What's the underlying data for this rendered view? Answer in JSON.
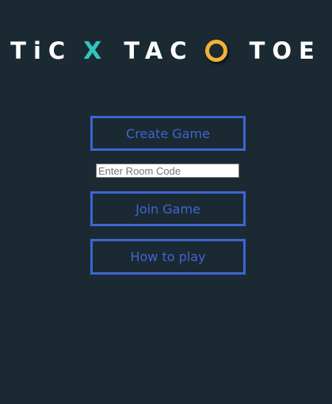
{
  "title": {
    "word1": "TiC",
    "x_mark": "X",
    "word2": "TAC",
    "word3": "TOE"
  },
  "menu": {
    "create_label": "Create Game",
    "room_code_placeholder": "Enter Room Code",
    "room_code_value": "",
    "join_label": "Join Game",
    "howto_label": "How to play"
  },
  "colors": {
    "background": "#1b2932",
    "accent_blue": "#3d66d1",
    "x_teal": "#31c4be",
    "o_gold": "#f2b137",
    "title_white": "#ffffff"
  },
  "icons": {
    "x_mark": "x-mark-icon",
    "o_mark": "o-ring-icon"
  }
}
